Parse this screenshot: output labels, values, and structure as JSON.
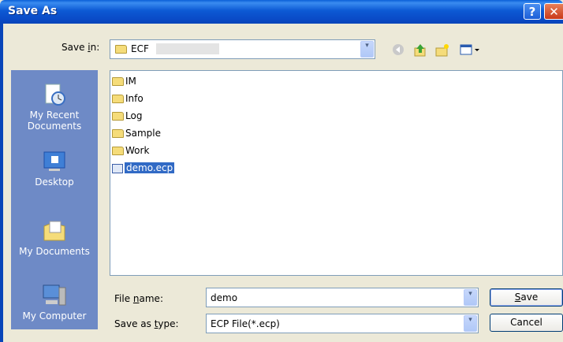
{
  "window": {
    "title": "Save As",
    "help_glyph": "?",
    "close_glyph": "✕"
  },
  "save_in": {
    "label": "Save in:",
    "value": "ECF",
    "dropdown_glyph": "▾"
  },
  "toolbar": {
    "back_icon": "back-icon",
    "up_icon": "up-folder-icon",
    "new_folder_icon": "new-folder-icon",
    "views_icon": "views-menu-icon"
  },
  "places": [
    {
      "label": "My Recent Documents",
      "icon": "recent-documents-icon"
    },
    {
      "label": "Desktop",
      "icon": "desktop-icon"
    },
    {
      "label": "My Documents",
      "icon": "my-documents-icon"
    },
    {
      "label": "My Computer",
      "icon": "my-computer-icon"
    }
  ],
  "files": [
    {
      "name": "IM",
      "type": "folder"
    },
    {
      "name": "Info",
      "type": "folder"
    },
    {
      "name": "Log",
      "type": "folder"
    },
    {
      "name": "Sample",
      "type": "folder"
    },
    {
      "name": "Work",
      "type": "folder"
    },
    {
      "name": "demo.ecp",
      "type": "file",
      "selected": true
    }
  ],
  "file_name": {
    "label": "File name:",
    "value": "demo"
  },
  "save_as_type": {
    "label": "Save as type:",
    "value": "ECP File(*.ecp)"
  },
  "buttons": {
    "save": "Save",
    "cancel": "Cancel"
  },
  "colors": {
    "titlebar": "#0a4bc7",
    "places_bar": "#6e8ac6",
    "selection": "#316ac5"
  }
}
